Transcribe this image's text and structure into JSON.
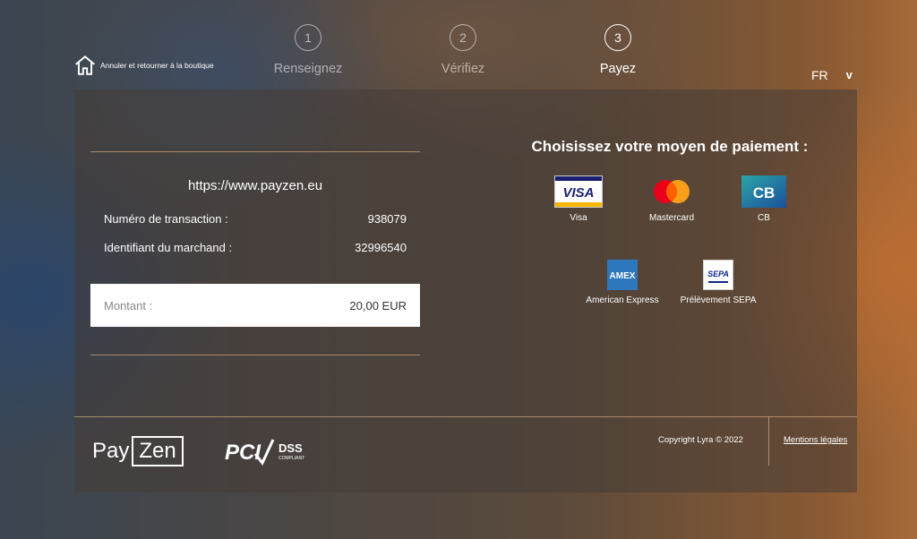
{
  "header": {
    "home_label": "Annuler et retourner à la boutique",
    "steps": [
      {
        "number": "1",
        "label": "Renseignez"
      },
      {
        "number": "2",
        "label": "Vérifiez"
      },
      {
        "number": "3",
        "label": "Payez"
      }
    ],
    "language": "FR",
    "language_chevron": "v"
  },
  "summary": {
    "shop_url": "https://www.payzen.eu",
    "transaction_label": "Numéro de transaction :",
    "transaction_value": "938079",
    "merchant_label": "Identifiant du marchand :",
    "merchant_value": "32996540",
    "amount_label": "Montant :",
    "amount_value": "20,00 EUR"
  },
  "payment": {
    "title": "Choisissez votre moyen de paiement :",
    "methods": [
      {
        "label": "Visa",
        "logo_text": "VISA"
      },
      {
        "label": "Mastercard"
      },
      {
        "label": "CB",
        "logo_text": "CB"
      },
      {
        "label": "American Express",
        "logo_text": "AMEX"
      },
      {
        "label": "Prélèvement SEPA",
        "logo_text": "SEPA"
      }
    ]
  },
  "footer": {
    "brand_pay": "Pay",
    "brand_zen": "Zen",
    "pci_text": "PCI",
    "dss_text": "DSS",
    "compliant_text": "COMPLIANT",
    "copyright": "Copyright Lyra © 2022",
    "legal": "Mentions légales"
  },
  "colors": {
    "visa_blue": "#1a1f71",
    "visa_gold": "#f7b600",
    "mc_red": "#eb001b",
    "mc_orange": "#f79e1b",
    "cb_blue": "#1b4f9c",
    "amex_blue": "#2e77bc"
  }
}
